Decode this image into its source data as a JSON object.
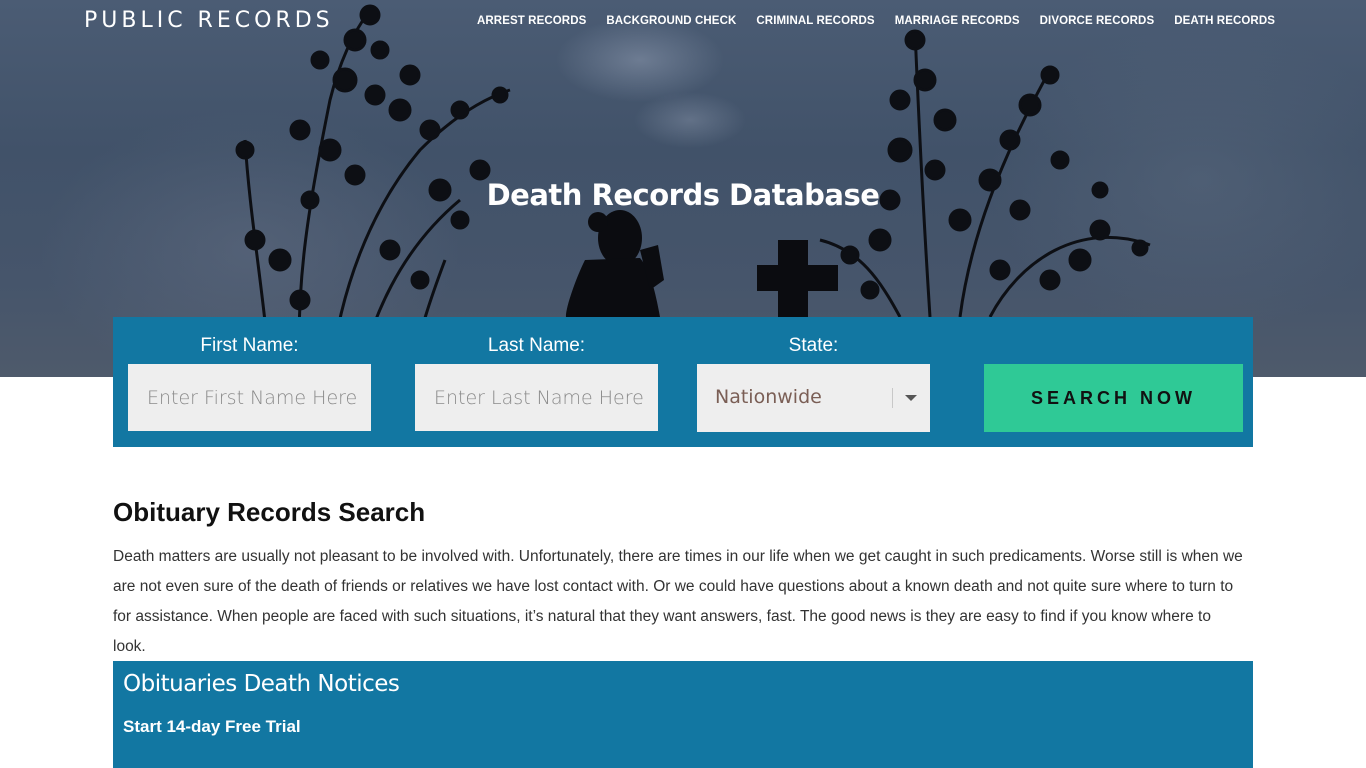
{
  "header": {
    "logo": "PUBLIC RECORDS",
    "nav": [
      {
        "label": "ARREST RECORDS"
      },
      {
        "label": "BACKGROUND CHECK"
      },
      {
        "label": "CRIMINAL RECORDS"
      },
      {
        "label": "MARRIAGE RECORDS"
      },
      {
        "label": "DIVORCE RECORDS"
      },
      {
        "label": "DEATH RECORDS"
      }
    ]
  },
  "hero": {
    "title": "Death Records Database"
  },
  "search": {
    "first_name_label": "First Name:",
    "first_name_placeholder": "Enter First Name Here",
    "first_name_value": "",
    "last_name_label": "Last Name:",
    "last_name_placeholder": "Enter Last Name Here",
    "last_name_value": "",
    "state_label": "State:",
    "state_selected": "Nationwide",
    "button_label": "SEARCH NOW"
  },
  "content": {
    "section_title": "Obituary Records Search",
    "intro": "Death matters are usually not pleasant to be involved with. Unfortunately, there are times in our life when we get caught in such predicaments. Worse still is when we are not even sure of the death of friends or relatives we have lost contact with. Or we could have questions about a known death and not quite sure where to turn to for assistance. When people are faced with such situations, it’s natural that they want answers, fast. The good news is they are easy to find if you know where to look."
  },
  "notice": {
    "title": "Obituaries Death Notices",
    "link": "Start 14-day Free Trial"
  },
  "colors": {
    "panel_blue": "#1277a2",
    "button_green": "#2fc996",
    "input_bg": "#eeeeee"
  }
}
